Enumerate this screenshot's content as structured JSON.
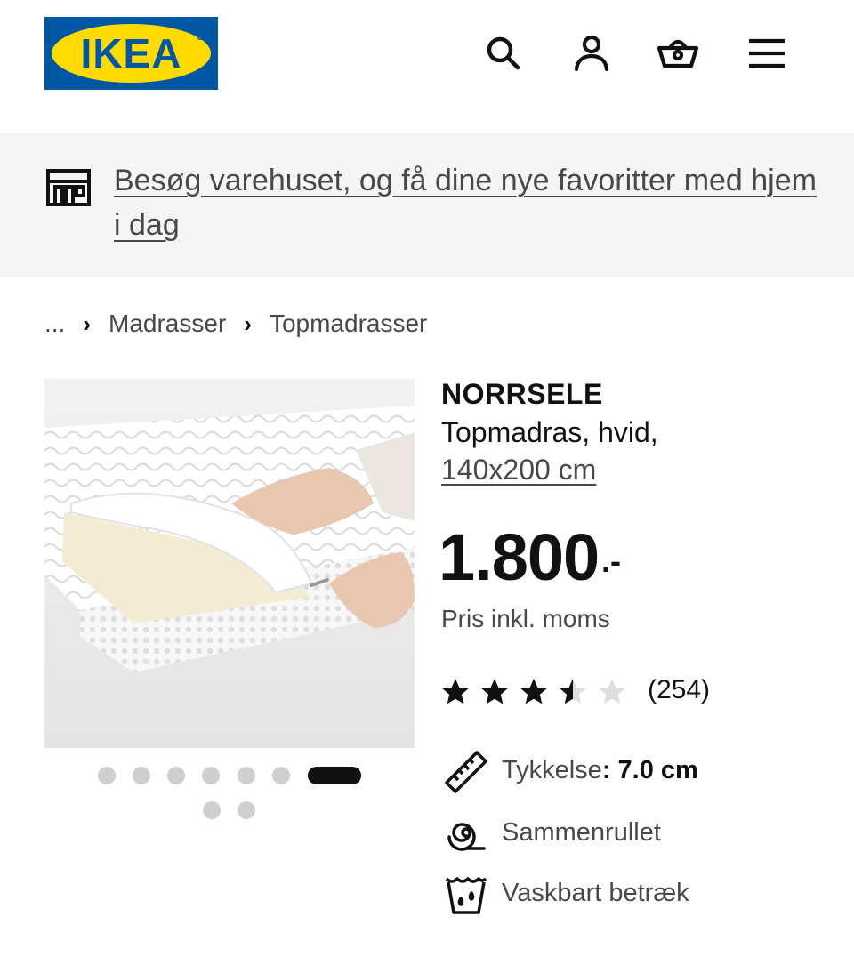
{
  "header": {
    "logo_text": "IKEA",
    "icons": [
      "search-icon",
      "account-icon",
      "basket-icon",
      "menu-icon"
    ]
  },
  "banner": {
    "icon": "store-icon",
    "link_text": "Besøg varehuset, og få dine nye favoritter med hjem i dag"
  },
  "breadcrumb": {
    "ellipsis": "...",
    "items": [
      "Madrasser",
      "Topmadrasser"
    ],
    "separator": "›"
  },
  "gallery": {
    "total_dots": 9,
    "active_index": 6
  },
  "product": {
    "name": "NORRSELE",
    "description": "Topmadras, hvid,",
    "size": "140x200 cm",
    "price": "1.800",
    "price_suffix": ".-",
    "vat_note": "Pris inkl. moms",
    "rating": 3.5,
    "rating_max": 5,
    "review_count": "(254)"
  },
  "features": [
    {
      "icon": "ruler-icon",
      "label": "Tykkelse",
      "value": ": 7.0 cm"
    },
    {
      "icon": "rolled-icon",
      "label": "Sammenrullet",
      "value": ""
    },
    {
      "icon": "washable-icon",
      "label": "Vaskbart betræk",
      "value": ""
    }
  ],
  "colors": {
    "brand_blue": "#0058a3",
    "brand_yellow": "#ffdb00",
    "banner_bg": "#f5f5f5",
    "text_dark": "#111111",
    "text_muted": "#484848"
  }
}
